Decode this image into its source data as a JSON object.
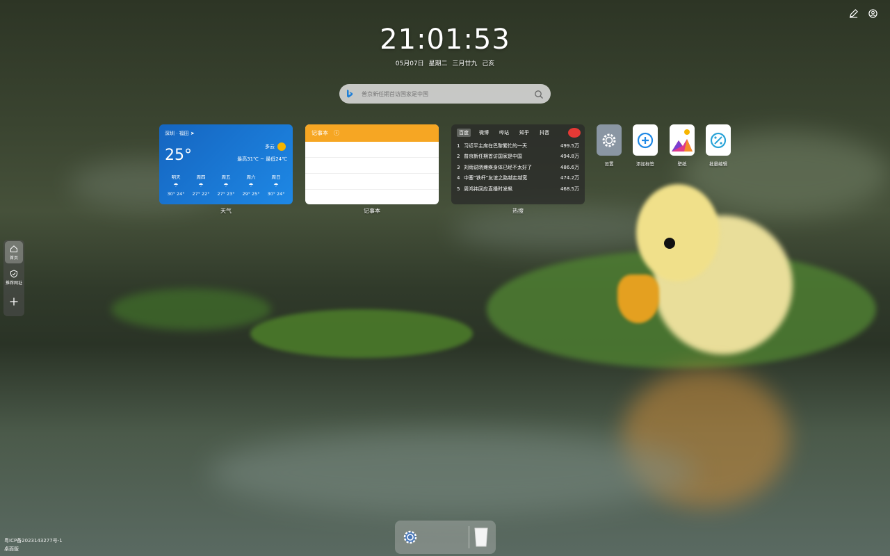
{
  "clock": {
    "time": "21:01:53",
    "date": "05月07日 星期二 三月廿九 己亥"
  },
  "search": {
    "placeholder": "普京新任期首访国家是中国"
  },
  "weather": {
    "location": "深圳 · 福田",
    "temp": "25°",
    "condition": "多云",
    "range": "最高31℃ ~ 最低24℃",
    "forecast": [
      {
        "day": "明天",
        "temps": "30° 24°"
      },
      {
        "day": "周四",
        "temps": "27° 22°"
      },
      {
        "day": "周五",
        "temps": "27° 23°"
      },
      {
        "day": "周六",
        "temps": "29° 25°"
      },
      {
        "day": "周日",
        "temps": "30° 24°"
      }
    ],
    "label": "天气"
  },
  "notepad": {
    "title": "记事本",
    "label": "记事本"
  },
  "hot": {
    "tabs": [
      "百度",
      "微博",
      "哔站",
      "知乎",
      "抖音"
    ],
    "items": [
      {
        "n": "1",
        "title": "习近平主席在巴黎繁忙的一天",
        "value": "499.5万"
      },
      {
        "n": "2",
        "title": "普京新任期首访国家是中国",
        "value": "494.8万"
      },
      {
        "n": "3",
        "title": "刘雨说晓瘫痪身体已经不太好了",
        "value": "486.6万"
      },
      {
        "n": "4",
        "title": "中塞“铁杆”友谊之路越走越宽",
        "value": "474.2万"
      },
      {
        "n": "5",
        "title": "周鸿祎回应直播时发飙",
        "value": "468.5万"
      }
    ],
    "label": "热搜"
  },
  "apps": [
    {
      "label": "设置",
      "icon": "gear-icon"
    },
    {
      "label": "添加标签",
      "icon": "plus-icon"
    },
    {
      "label": "壁纸",
      "icon": "wallpaper-icon"
    },
    {
      "label": "批量编辑",
      "icon": "batch-icon"
    }
  ],
  "sidenav": {
    "home": "首页",
    "recommended": "推荐网址"
  },
  "footer": {
    "icp": "粤ICP备2023143277号-1",
    "desktop": "桌面版"
  }
}
